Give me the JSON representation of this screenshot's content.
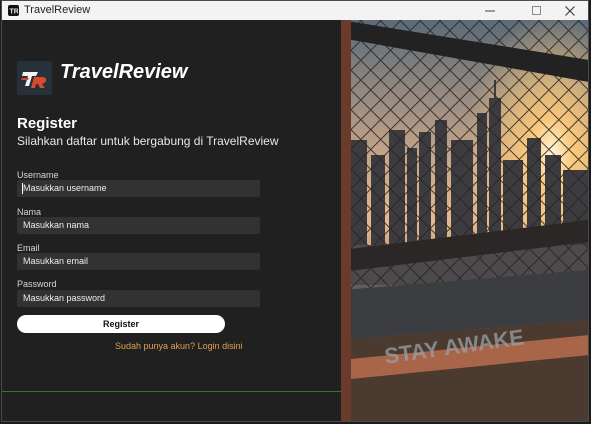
{
  "window": {
    "title": "TravelReview"
  },
  "brand": {
    "name": "TravelReview"
  },
  "form": {
    "heading": "Register",
    "subheading": "Silahkan daftar untuk bergabung di TravelReview",
    "fields": [
      {
        "label": "Username",
        "placeholder": "Masukkan username"
      },
      {
        "label": "Nama",
        "placeholder": "Masukkan nama"
      },
      {
        "label": "Email",
        "placeholder": "Masukkan email"
      },
      {
        "label": "Password",
        "placeholder": "Masukkan password"
      }
    ],
    "submit_label": "Register",
    "login_link": "Sudah punya akun? Login disini"
  },
  "photo": {
    "overlay_text": "STAY AWAKE"
  },
  "colors": {
    "panel": "#202020",
    "field": "#323232",
    "link": "#e0a050",
    "button": "#ffffff"
  },
  "icons": [
    "app-icon",
    "minimize-icon",
    "maximize-icon",
    "close-icon",
    "travelreview-logo-icon"
  ]
}
